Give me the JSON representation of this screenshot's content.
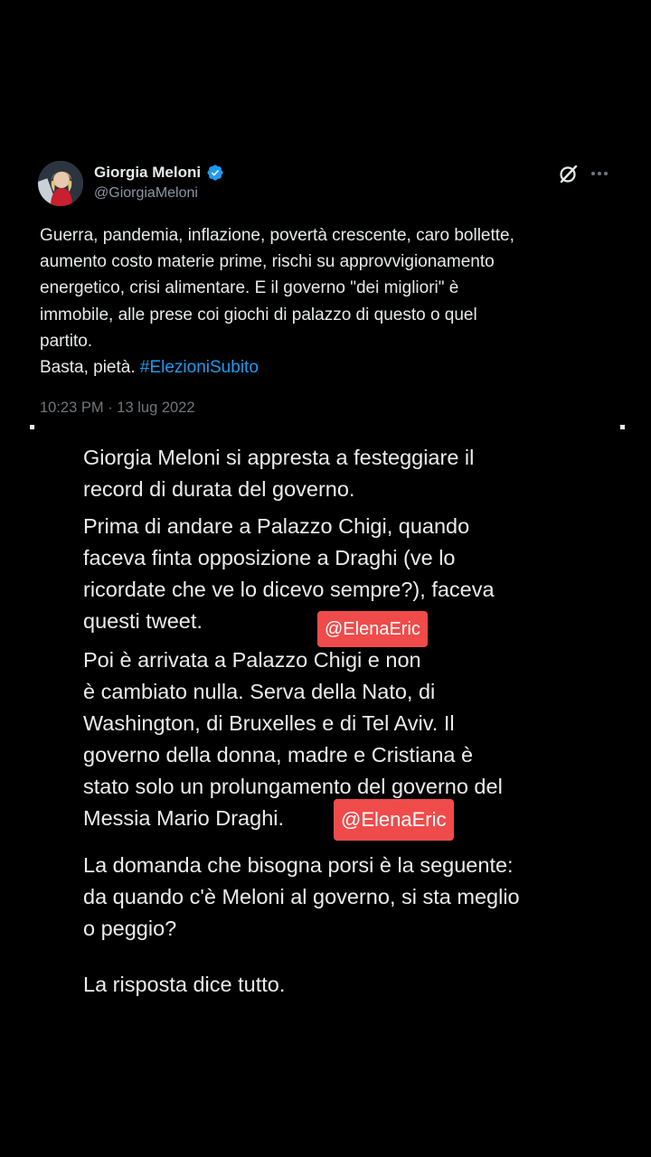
{
  "tweet": {
    "author_name": "Giorgia Meloni",
    "handle": "@GiorgiaMeloni",
    "text_lines": [
      "Guerra, pandemia, inflazione, povertà crescente, caro bollette,",
      "aumento costo materie prime, rischi su approvvigionamento",
      "energetico, crisi alimentare. E il governo \"dei migliori\" è",
      "immobile, alle prese coi giochi di palazzo di questo o quel",
      "partito."
    ],
    "last_line_prefix": "Basta, pietà. ",
    "hashtag": "#ElezioniSubito",
    "timestamp": "10:23 PM · 13 lug 2022",
    "icons": [
      "verified-badge-icon",
      "grok-icon",
      "more-options-icon"
    ],
    "colors": {
      "hashtag": "#1d9bf0",
      "verified": "#1d9bf0"
    }
  },
  "commentary": {
    "paragraph1": [
      "Giorgia Meloni si appresta a festeggiare il",
      "record di durata del governo."
    ],
    "paragraph2": [
      "Prima di andare a Palazzo Chigi, quando",
      "faceva finta opposizione a Draghi (ve lo",
      "ricordate che ve lo dicevo sempre?), faceva",
      "questi tweet."
    ],
    "paragraph3": [
      "Poi è arrivata a Palazzo Chigi e non",
      "è cambiato nulla. Serva della Nato, di",
      "Washington, di Bruxelles e di Tel Aviv. Il",
      "governo della donna, madre e Cristiana è",
      "stato solo un prolungamento del governo del",
      "Messia Mario Draghi."
    ],
    "paragraph4": [
      "La domanda che bisogna porsi è la seguente:",
      "da quando c'è Meloni al governo, si sta meglio",
      "o peggio?"
    ],
    "paragraph5": [
      "La risposta dice tutto."
    ]
  },
  "watermarks": [
    "@ElenaEric",
    "@ElenaEric"
  ],
  "colors": {
    "watermark_bg": "#ef4b4b",
    "background": "#000000"
  }
}
